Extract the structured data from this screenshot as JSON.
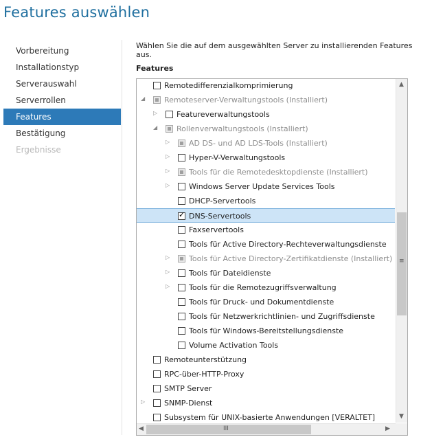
{
  "title": "Features auswählen",
  "nav": [
    {
      "label": "Vorbereitung",
      "state": "normal"
    },
    {
      "label": "Installationstyp",
      "state": "normal"
    },
    {
      "label": "Serverauswahl",
      "state": "normal"
    },
    {
      "label": "Serverrollen",
      "state": "normal"
    },
    {
      "label": "Features",
      "state": "active"
    },
    {
      "label": "Bestätigung",
      "state": "normal"
    },
    {
      "label": "Ergebnisse",
      "state": "disabled"
    }
  ],
  "description": "Wählen Sie die auf dem ausgewählten Server zu installierenden Features aus.",
  "features_label": "Features",
  "tree": [
    {
      "label": "Remotedifferenzialkomprimierung",
      "level": 0,
      "expander": "none",
      "check": "empty",
      "dim": false
    },
    {
      "label": "Remoteserver-Verwaltungstools (Installiert)",
      "level": 0,
      "expander": "expanded",
      "check": "indeterminate",
      "dim": true
    },
    {
      "label": "Featureverwaltungstools",
      "level": 1,
      "expander": "collapsed",
      "check": "empty",
      "dim": false
    },
    {
      "label": "Rollenverwaltungstools (Installiert)",
      "level": 1,
      "expander": "expanded",
      "check": "indeterminate",
      "dim": true
    },
    {
      "label": "AD DS- und AD LDS-Tools (Installiert)",
      "level": 2,
      "expander": "collapsed",
      "check": "indeterminate",
      "dim": true
    },
    {
      "label": "Hyper-V-Verwaltungstools",
      "level": 2,
      "expander": "collapsed",
      "check": "empty",
      "dim": false
    },
    {
      "label": "Tools für die Remotedesktopdienste (Installiert)",
      "level": 2,
      "expander": "collapsed",
      "check": "indeterminate",
      "dim": true
    },
    {
      "label": "Windows Server Update Services Tools",
      "level": 2,
      "expander": "collapsed",
      "check": "empty",
      "dim": false
    },
    {
      "label": "DHCP-Servertools",
      "level": 2,
      "expander": "none",
      "check": "empty",
      "dim": false
    },
    {
      "label": "DNS-Servertools",
      "level": 2,
      "expander": "none",
      "check": "checked",
      "dim": false,
      "selected": true
    },
    {
      "label": "Faxservertools",
      "level": 2,
      "expander": "none",
      "check": "empty",
      "dim": false
    },
    {
      "label": "Tools für Active Directory-Rechteverwaltungsdienste",
      "level": 2,
      "expander": "none",
      "check": "empty",
      "dim": false
    },
    {
      "label": "Tools für Active Directory-Zertifikatdienste (Installiert)",
      "level": 2,
      "expander": "collapsed",
      "check": "indeterminate",
      "dim": true
    },
    {
      "label": "Tools für Dateidienste",
      "level": 2,
      "expander": "collapsed",
      "check": "empty",
      "dim": false
    },
    {
      "label": "Tools für die Remotezugriffsverwaltung",
      "level": 2,
      "expander": "collapsed",
      "check": "empty",
      "dim": false
    },
    {
      "label": "Tools für Druck- und Dokumentdienste",
      "level": 2,
      "expander": "none",
      "check": "empty",
      "dim": false
    },
    {
      "label": "Tools für Netzwerkrichtlinien- und Zugriffsdienste",
      "level": 2,
      "expander": "none",
      "check": "empty",
      "dim": false
    },
    {
      "label": "Tools für Windows-Bereitstellungsdienste",
      "level": 2,
      "expander": "none",
      "check": "empty",
      "dim": false
    },
    {
      "label": "Volume Activation Tools",
      "level": 2,
      "expander": "none",
      "check": "empty",
      "dim": false
    },
    {
      "label": "Remoteunterstützung",
      "level": 0,
      "expander": "none",
      "check": "empty",
      "dim": false
    },
    {
      "label": "RPC-über-HTTP-Proxy",
      "level": 0,
      "expander": "none",
      "check": "empty",
      "dim": false
    },
    {
      "label": "SMTP Server",
      "level": 0,
      "expander": "none",
      "check": "empty",
      "dim": false
    },
    {
      "label": "SNMP-Dienst",
      "level": 0,
      "expander": "collapsed",
      "check": "empty",
      "dim": false
    },
    {
      "label": "Subsystem für UNIX-basierte Anwendungen [VERALTET]",
      "level": 0,
      "expander": "none",
      "check": "empty",
      "dim": false
    }
  ],
  "icons": {
    "scroll_up": "▲",
    "scroll_down": "▼",
    "scroll_left": "◀",
    "scroll_right": "▶",
    "grip_v": "≡",
    "grip_h": "III",
    "expanded": "◢",
    "collapsed": "▷"
  }
}
